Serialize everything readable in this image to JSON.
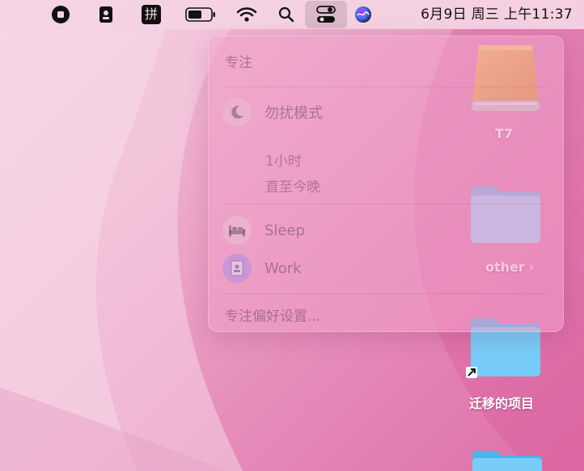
{
  "menubar": {
    "items": [
      {
        "icon": "stop-icon"
      },
      {
        "icon": "badge-icon"
      },
      {
        "icon": "input-method-icon",
        "label": "拼"
      },
      {
        "icon": "battery-icon"
      },
      {
        "icon": "wifi-icon"
      },
      {
        "icon": "search-icon"
      },
      {
        "icon": "control-center-icon"
      },
      {
        "icon": "siri-icon"
      }
    ],
    "clock": "6月9日 周三 上午11:37"
  },
  "focus_panel": {
    "title": "专注",
    "do_not_disturb": {
      "label": "勿扰模式",
      "icon": "moon-icon"
    },
    "dnd_options": [
      "1小时",
      "直至今晚"
    ],
    "modes": [
      {
        "label": "Sleep",
        "icon": "bed-icon"
      },
      {
        "label": "Work",
        "icon": "id-badge-icon"
      }
    ],
    "preferences": "专注偏好设置..."
  },
  "desktop": {
    "items": [
      {
        "label": "T7",
        "icon": "external-drive-icon"
      },
      {
        "label": "other",
        "icon": "folder-icon"
      },
      {
        "label": "迁移的项目",
        "icon": "folder-alias-icon"
      }
    ]
  },
  "colors": {
    "wallpaper": "#e68fbb",
    "folder_blue": "#8cc9f5",
    "drive_orange": "#e8a23a"
  }
}
